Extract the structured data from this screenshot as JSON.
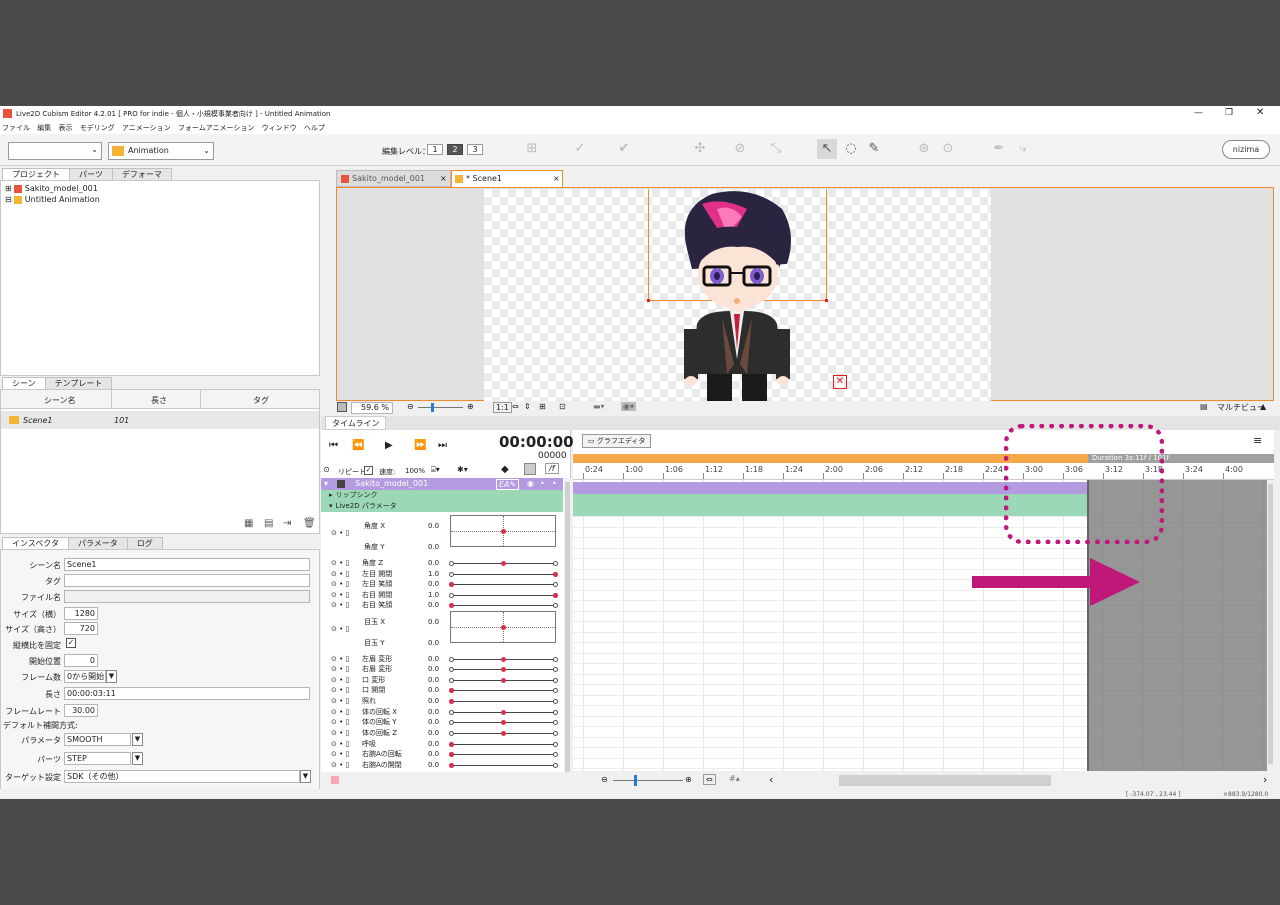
{
  "window": {
    "title": "Live2D Cubism Editor 4.2.01  [ PRO for indie - 個人・小規模事業者向け ] - Untitled Animation",
    "controls": [
      "—",
      "❐",
      "✕"
    ]
  },
  "menu": [
    "ファイル",
    "編集",
    "表示",
    "モデリング",
    "アニメーション",
    "フォームアニメーション",
    "ウィンドウ",
    "ヘルプ"
  ],
  "toolbar": {
    "mode_combo": "",
    "workspace_combo": "Animation",
    "edit_level_label": "編集レベル：",
    "edit_levels": [
      "1",
      "2",
      "3"
    ],
    "brand": "nizima"
  },
  "project": {
    "tabs": [
      "プロジェクト",
      "パーツ",
      "デフォーマ"
    ],
    "items": [
      "Sakito_model_001",
      "Untitled Animation"
    ]
  },
  "scenes": {
    "tabs": [
      "シーン",
      "テンプレート"
    ],
    "columns": [
      "シーン名",
      "長さ",
      "タグ"
    ],
    "rows": [
      {
        "name": "Scene1",
        "length": "101",
        "tag": ""
      }
    ]
  },
  "inspector": {
    "tabs": [
      "インスペクタ",
      "パラメータ",
      "ログ"
    ],
    "scene_name_label": "シーン名",
    "scene_name": "Scene1",
    "tag_label": "タグ",
    "tag": "",
    "file_label": "ファイル名",
    "file": "",
    "width_label": "サイズ（横）",
    "width": "1280",
    "height_label": "サイズ（高さ）",
    "height": "720",
    "aspect_label": "縦横比を固定",
    "start_label": "開始位置",
    "start": "0",
    "frames_label": "フレーム数",
    "frames": "0から開始",
    "length_label": "長さ",
    "length": "00:00:03:11",
    "framerate_label": "フレームレート",
    "framerate": "30.00",
    "interp_label": "デフォルト補間方式:",
    "param_label": "パラメータ",
    "param_interp": "SMOOTH",
    "parts_label": "パーツ",
    "parts_interp": "STEP",
    "target_label": "ターゲット設定",
    "target": "SDK（その他）"
  },
  "editor_tabs": [
    {
      "label": "Sakito_model_001",
      "close": "×"
    },
    {
      "label": "* Scene1",
      "close": "×"
    }
  ],
  "viewport": {
    "zoom": "59.6 %",
    "ratio": "1:1",
    "view_menu": "マルチビュー"
  },
  "timeline": {
    "tab": "タイムライン",
    "time": "00:00:00",
    "frame": "00000",
    "graph_editor": "グラフエディタ",
    "repeat_label": "リピート",
    "speed_label": "速度:",
    "speed": "100%",
    "fx": "/f",
    "duration": "Duration 3s:11f / 101f",
    "ticks": [
      "0:24",
      "1:00",
      "1:06",
      "1:12",
      "1:18",
      "1:24",
      "2:00",
      "2:06",
      "2:12",
      "2:18",
      "2:24",
      "3:00",
      "3:06",
      "3:12",
      "3:18",
      "3:24",
      "4:00"
    ],
    "model_track": "Sakito_model_001",
    "groups": [
      "リップシンク",
      "Live2D パラメータ"
    ],
    "params": [
      {
        "name": "角度 X",
        "value": "0.0"
      },
      {
        "name": "角度 Y",
        "value": "0.0"
      },
      {
        "name": "角度 Z",
        "value": "0.0"
      },
      {
        "name": "左目 開閉",
        "value": "1.0"
      },
      {
        "name": "左目 笑顔",
        "value": "0.0"
      },
      {
        "name": "右目 開閉",
        "value": "1.0"
      },
      {
        "name": "右目 笑顔",
        "value": "0.0"
      },
      {
        "name": "目玉 X",
        "value": "0.0"
      },
      {
        "name": "目玉 Y",
        "value": "0.0"
      },
      {
        "name": "左眉 変形",
        "value": "0.0"
      },
      {
        "name": "右眉 変形",
        "value": "0.0"
      },
      {
        "name": "口 変形",
        "value": "0.0"
      },
      {
        "name": "口 開閉",
        "value": "0.0"
      },
      {
        "name": "照れ",
        "value": "0.0"
      },
      {
        "name": "体の回転 X",
        "value": "0.0"
      },
      {
        "name": "体の回転 Y",
        "value": "0.0"
      },
      {
        "name": "体の回転 Z",
        "value": "0.0"
      },
      {
        "name": "呼吸",
        "value": "0.0"
      },
      {
        "name": "右腕Aの回転",
        "value": "0.0"
      },
      {
        "name": "右腕Aの開閉",
        "value": "0.0"
      }
    ]
  },
  "status": {
    "coords": "[ -374.07 ,   23.44 ]",
    "zoom": "×883.9/1280.0"
  },
  "colors": {
    "accent_orange": "#f08a2a",
    "duration_bar": "#f4a84a",
    "model_track": "#b49be0",
    "param_track": "#9ad8b8",
    "annotation": "#c0187a",
    "key_dot": "#d9304f"
  }
}
